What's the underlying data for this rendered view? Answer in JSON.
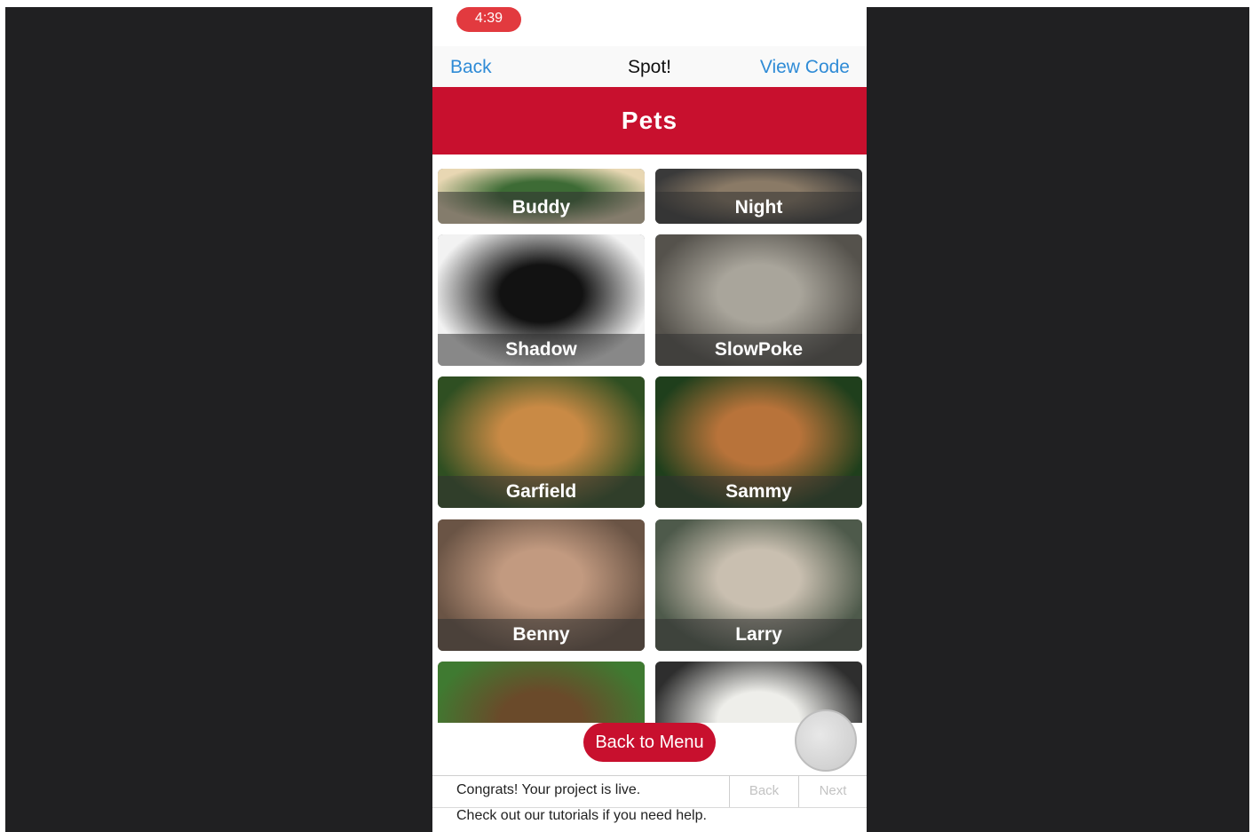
{
  "status": {
    "time": "4:39"
  },
  "nav": {
    "back_label": "Back",
    "title": "Spot!",
    "view_code_label": "View Code"
  },
  "header": {
    "title": "Pets"
  },
  "pets": [
    {
      "name": "Buddy",
      "colors": [
        "#e8d7b3",
        "#3d6b35"
      ]
    },
    {
      "name": "Night",
      "colors": [
        "#3a3a3a",
        "#8a7a66"
      ]
    },
    {
      "name": "Shadow",
      "colors": [
        "#f2f2f2",
        "#121212"
      ]
    },
    {
      "name": "SlowPoke",
      "colors": [
        "#55524c",
        "#a9a59b"
      ]
    },
    {
      "name": "Garfield",
      "colors": [
        "#2f4f22",
        "#c98a45"
      ]
    },
    {
      "name": "Sammy",
      "colors": [
        "#1f3f1c",
        "#b8733a"
      ]
    },
    {
      "name": "Benny",
      "colors": [
        "#6a5445",
        "#c29a80"
      ]
    },
    {
      "name": "Larry",
      "colors": [
        "#4e5a4b",
        "#c9bfb0"
      ]
    },
    {
      "name": "",
      "colors": [
        "#3f7a31",
        "#6a4a2a"
      ]
    },
    {
      "name": "",
      "colors": [
        "#2e2e2e",
        "#eeeeea"
      ]
    }
  ],
  "buttons": {
    "back_to_menu": "Back to Menu"
  },
  "footer": {
    "message": "Congrats! Your project is live.",
    "help": "Check out our tutorials if you need help.",
    "back_label": "Back",
    "next_label": "Next"
  },
  "colors": {
    "brand_red": "#c8102e",
    "link_blue": "#2f8bd6",
    "status_red": "#e23a3f"
  }
}
